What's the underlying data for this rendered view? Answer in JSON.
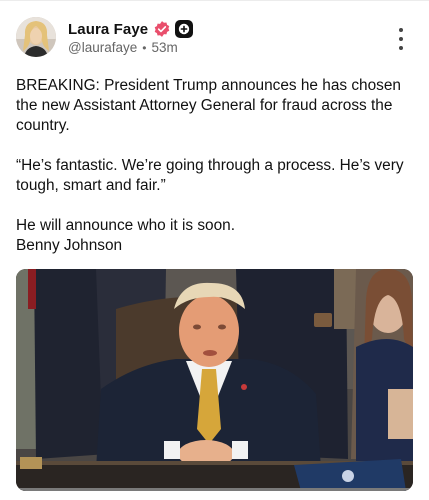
{
  "author": {
    "name": "Laura Faye",
    "handle": "@laurafaye",
    "separator": "•",
    "time": "53m",
    "verified_color": "#e94f6c",
    "badge_color": "#111111"
  },
  "post": {
    "paragraphs": [
      "BREAKING: President Trump announces he has chosen the new Assistant Attorney General for fraud across the country.",
      "“He’s fantastic. We’re going through a process. He’s very tough, smart and fair.”"
    ],
    "closing_line_1": "He will announce who it is soon.",
    "closing_line_2": "Benny Johnson"
  },
  "icons": {
    "verified": "verified-badge-icon",
    "plus": "plus-badge-icon",
    "more": "more-options-icon"
  }
}
